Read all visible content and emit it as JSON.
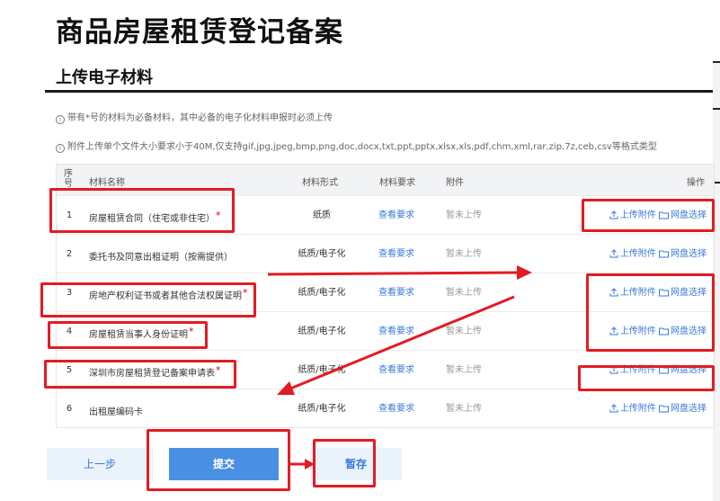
{
  "page_title": "商品房屋租赁登记备案",
  "section_title": "上传电子材料",
  "notes": [
    "带有*号的材料为必备材料，其中必备的电子化材料申报时必须上传",
    "附件上传单个文件大小要求小于40M,仅支持gif,jpg,jpeg,bmp,png,doc,docx,txt,ppt,pptx,xlsx,xls,pdf,chm,xml,rar,zip,7z,ceb,csv等格式类型"
  ],
  "info_icon": "i",
  "table": {
    "headers": {
      "seq": "序号",
      "name": "材料名称",
      "form": "材料形式",
      "requirement": "材料要求",
      "attachment": "附件",
      "action": "操作"
    },
    "rows": [
      {
        "seq": "1",
        "name": "房屋租赁合同（住宅或非住宅）",
        "required": "*",
        "form": "纸质",
        "requirement": "查看要求",
        "attachment": "暂未上传",
        "upload": "上传附件",
        "cloud": "网盘选择"
      },
      {
        "seq": "2",
        "name": "委托书及同意出租证明（按需提供）",
        "required": "",
        "form": "纸质/电子化",
        "requirement": "查看要求",
        "attachment": "暂未上传",
        "upload": "上传附件",
        "cloud": "网盘选择"
      },
      {
        "seq": "3",
        "name": "房地产权利证书或者其他合法权属证明",
        "required": "*",
        "form": "纸质/电子化",
        "requirement": "查看要求",
        "attachment": "暂未上传",
        "upload": "上传附件",
        "cloud": "网盘选择"
      },
      {
        "seq": "4",
        "name": "房屋租赁当事人身份证明",
        "required": "*",
        "form": "纸质/电子化",
        "requirement": "查看要求",
        "attachment": "暂未上传",
        "upload": "上传附件",
        "cloud": "网盘选择"
      },
      {
        "seq": "5",
        "name": "深圳市房屋租赁登记备案申请表",
        "required": "*",
        "form": "纸质/电子化",
        "requirement": "查看要求",
        "attachment": "暂未上传",
        "upload": "上传附件",
        "cloud": "网盘选择"
      },
      {
        "seq": "6",
        "name": "出租屋编码卡",
        "required": "",
        "form": "纸质/电子化",
        "requirement": "查看要求",
        "attachment": "暂未上传",
        "upload": "上传附件",
        "cloud": "网盘选择"
      }
    ]
  },
  "buttons": {
    "prev": "上一步",
    "submit": "提交",
    "save": "暂存"
  },
  "icons": {
    "upload": "upload-icon",
    "folder": "folder-icon"
  },
  "colors": {
    "accent": "#3a7ad8",
    "primary_button": "#4a90e2",
    "annotation": "#e31b23",
    "muted": "#9a9a9a"
  }
}
